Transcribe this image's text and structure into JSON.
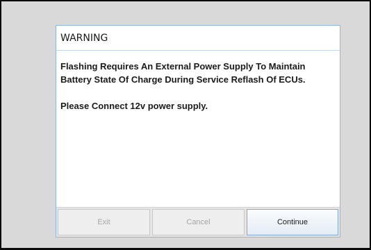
{
  "dialog": {
    "title": "WARNING",
    "message_line_1": "Flashing Requires An External Power Supply To Maintain",
    "message_line_2": "Battery State Of Charge During Service Reflash Of ECUs.",
    "message_line_3": "Please Connect 12v power supply."
  },
  "buttons": {
    "exit_label": "Exit",
    "cancel_label": "Cancel",
    "continue_label": "Continue"
  },
  "colors": {
    "background": "#d9d9d9",
    "dialog_border": "#8eb6de",
    "disabled_text": "#a6a6a6",
    "enabled_text": "#1a1a1a"
  }
}
